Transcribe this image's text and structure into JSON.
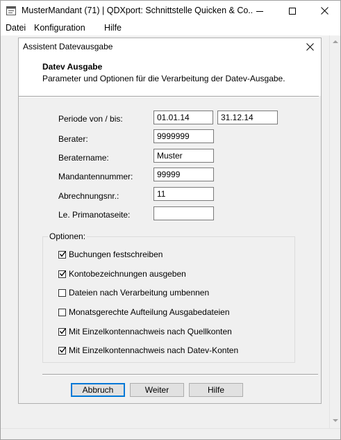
{
  "window": {
    "title": "MusterMandant (71) | QDXport: Schnittstelle Quicken & Co..."
  },
  "menu": {
    "items": [
      {
        "label": "Datei"
      },
      {
        "label": "Konfiguration"
      },
      {
        "label": "Hilfe"
      }
    ]
  },
  "dialog": {
    "title": "Assistent Datevausgabe",
    "header": {
      "title": "Datev Ausgabe",
      "subtitle": "Parameter und Optionen für die Verarbeitung der Datev-Ausgabe."
    },
    "fields": {
      "periode_label": "Periode von / bis:",
      "periode_von": "01.01.14",
      "periode_bis": "31.12.14",
      "berater_label": "Berater:",
      "berater": "9999999",
      "beratername_label": "Beratername:",
      "beratername": "Muster",
      "mandantennummer_label": "Mandantennummer:",
      "mandantennummer": "99999",
      "abrechnungsnr_label": "Abrechnungsnr.:",
      "abrechnungsnr": "11",
      "primanotaseite_label": "Le. Primanotaseite:",
      "primanotaseite": ""
    },
    "options": {
      "group_label": "Optionen:",
      "items": [
        {
          "label": "Buchungen festschreiben",
          "checked": true
        },
        {
          "label": "Kontobezeichnungen ausgeben",
          "checked": true
        },
        {
          "label": "Dateien nach Verarbeitung umbennen",
          "checked": false
        },
        {
          "label": "Monatsgerechte Aufteilung Ausgabedateien",
          "checked": false
        },
        {
          "label": "Mit Einzelkontennachweis nach Quellkonten",
          "checked": true
        },
        {
          "label": "Mit Einzelkontennachweis nach Datev-Konten",
          "checked": true
        }
      ]
    },
    "buttons": {
      "abbruch": "Abbruch",
      "weiter": "Weiter",
      "hilfe": "Hilfe"
    }
  },
  "colors": {
    "accent": "#0078d7",
    "background": "#f0f0f0",
    "titlebar": "#ffffff"
  },
  "icons": {
    "app": "app-icon",
    "minimize": "minimize-icon",
    "maximize": "maximize-icon",
    "close": "close-icon",
    "check": "checkmark-icon"
  }
}
